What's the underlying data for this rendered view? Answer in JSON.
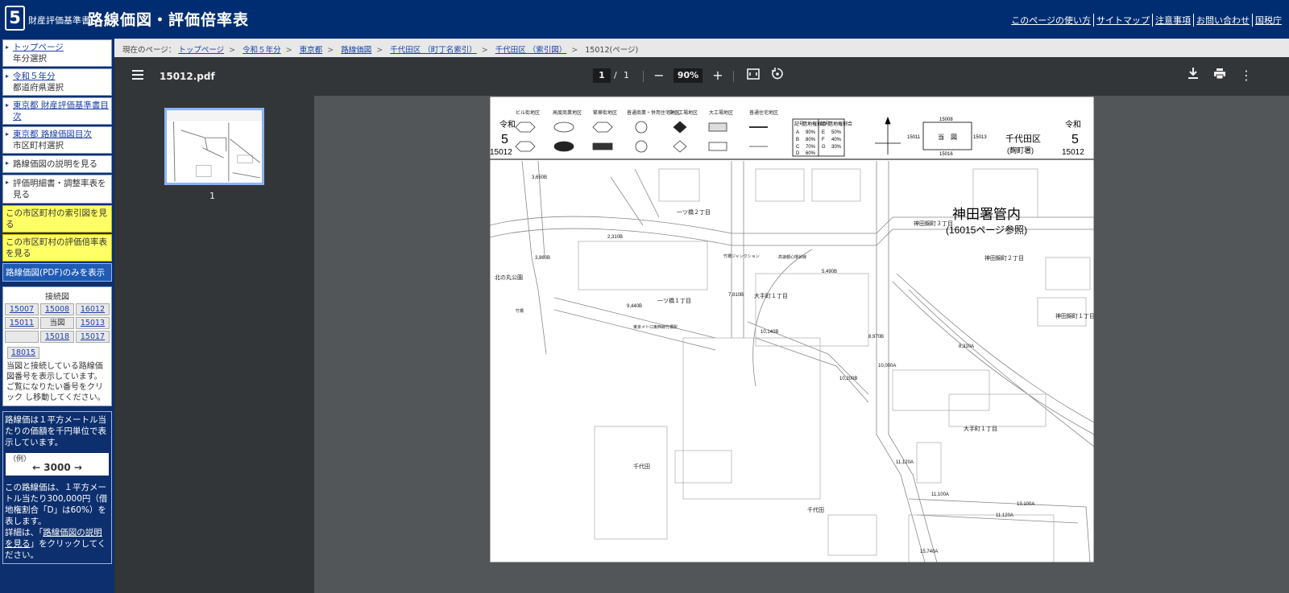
{
  "header": {
    "logo_number": "5",
    "logo_sub": "財産評価基準書",
    "logo_main": "路線価図・評価倍率表",
    "links": [
      "このページの使い方",
      "サイトマップ",
      "注意事項",
      "お問い合わせ",
      "国税庁"
    ]
  },
  "sidebar": {
    "nav": [
      {
        "link": "トップページ",
        "sub": "年分選択"
      },
      {
        "link": "令和５年分",
        "sub": "都道府県選択"
      },
      {
        "link": "東京都 財産評価基準書目次",
        "sub": ""
      },
      {
        "link": "東京都 路線価図目次",
        "sub": "市区町村選択"
      }
    ],
    "plain": [
      "路線価図の説明を見る",
      "評価明細書・調整率表を見る"
    ],
    "highlight": [
      "この市区町村の索引図を見る",
      "この市区町村の評価倍率表を見る"
    ],
    "pdf_only": "路線価図(PDF)のみを表示",
    "connection": {
      "title": "接続図",
      "cells": [
        "15007",
        "15008",
        "16012",
        "15011",
        "当図",
        "15013",
        "",
        "15018",
        "15017"
      ],
      "extra": "18015",
      "note": "当図と接続している路線価図番号を表示しています。ご覧になりたい番号をクリック し移動してください。"
    },
    "explanation": {
      "intro": "路線価は１平方メートル当たりの価額を千円単位で表示しています。",
      "example_label": "（例）",
      "example_value": "← 3000 →",
      "detail": "この路線価は、１平方メートル当たり300,000円（借地権割合「D」は60%）を表します。",
      "more_prefix": "詳細は、「",
      "more_link": "路線価図の説明を見る",
      "more_suffix": "」をクリックしてください。"
    }
  },
  "breadcrumb": {
    "prefix": "現在のページ：",
    "links": [
      "トップページ",
      "令和５年分",
      "東京都",
      "路線価図",
      "千代田区 （町丁名索引）",
      "千代田区 （索引図）"
    ],
    "current": "15012(ページ)"
  },
  "viewer": {
    "filename": "15012.pdf",
    "page_current": "1",
    "page_total": "1",
    "zoom": "90%",
    "thumb_label": "1"
  },
  "map": {
    "era": "令和",
    "year": "5",
    "code": "15012",
    "ward": "千代田区",
    "office": "(麹町署)",
    "legend_categories": [
      "ビル街地区",
      "高度商業地区",
      "繁華街地区",
      "普通商業・併用住宅地区",
      "中小工場地区",
      "大工場地区",
      "普通住宅地区"
    ],
    "ratio_table": {
      "headers": [
        "記号",
        "借地権割合",
        "記号",
        "借地権割合"
      ],
      "rows": [
        [
          "A",
          "90%",
          "E",
          "50%"
        ],
        [
          "B",
          "80%",
          "F",
          "40%"
        ],
        [
          "C",
          "70%",
          "G",
          "30%"
        ],
        [
          "D",
          "60%",
          "",
          ""
        ]
      ]
    },
    "index": {
      "top": "15008",
      "left": "15011",
      "center": "当　図",
      "right": "15013",
      "bottom": "15016"
    },
    "kanda_title": "神田署管内",
    "kanda_sub": "(16015ページ参照)",
    "places": [
      "一ツ橋２丁目",
      "一ツ橋１丁目",
      "神田錦町３丁目",
      "神田錦町２丁目",
      "神田錦町１丁目",
      "大手町１丁目",
      "大手町１丁目",
      "北の丸公園",
      "千代田",
      "千代田",
      "高速都心環状線",
      "竹橋",
      "竹橋ジャンクション",
      "東京メトロ東西線竹橋駅"
    ],
    "prices": [
      "3,650B",
      "2,310B",
      "3,860B",
      "9,440B",
      "7,810B",
      "5,490B",
      "10,140B",
      "8,970B",
      "10,200B",
      "10,000A",
      "8,310A",
      "11,120A",
      "11,100A",
      "13,100A",
      "11,120A",
      "15,740A"
    ]
  }
}
